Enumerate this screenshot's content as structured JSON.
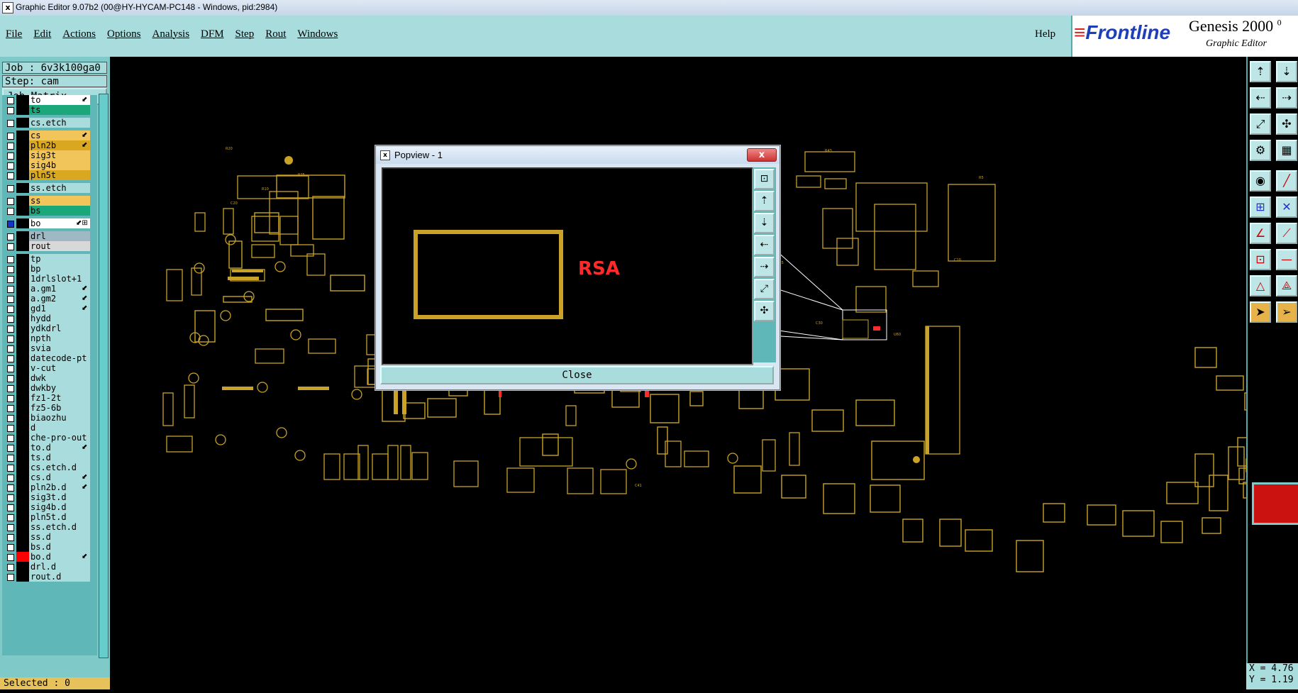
{
  "window": {
    "title": "Graphic Editor 9.07b2 (00@HY-HYCAM-PC148 - Windows, pid:2984)"
  },
  "menu": [
    "File",
    "Edit",
    "Actions",
    "Options",
    "Analysis",
    "DFM",
    "Step",
    "Rout",
    "Windows"
  ],
  "help": "Help",
  "brand": {
    "name": "Frontline",
    "product": "Genesis 2000",
    "version_fragment": "0",
    "subtitle": "Graphic Editor"
  },
  "job": {
    "job_label": "Job : 6v3k100ga0",
    "step_label": "Step: cam",
    "matrix_button": "Job Matrix ..."
  },
  "layers": [
    {
      "name": "to",
      "color": "#ffffff",
      "flag": "⬋"
    },
    {
      "name": "ts",
      "color": "#1aa77a",
      "flag": ""
    },
    {
      "name": "cs.etch",
      "color": "#a9dcdc",
      "flag": ""
    },
    {
      "name": "cs",
      "color": "#f2c55a",
      "flag": "⬋"
    },
    {
      "name": "pln2b",
      "color": "#d9a820",
      "flag": "⬋"
    },
    {
      "name": "sig3t",
      "color": "#f2c55a",
      "flag": ""
    },
    {
      "name": "sig4b",
      "color": "#f2c55a",
      "flag": ""
    },
    {
      "name": "pln5t",
      "color": "#d9a820",
      "flag": ""
    },
    {
      "name": "ss.etch",
      "color": "#a9dcdc",
      "flag": ""
    },
    {
      "name": "ss",
      "color": "#f2c55a",
      "flag": ""
    },
    {
      "name": "bs",
      "color": "#1aa77a",
      "flag": ""
    },
    {
      "name": "bo",
      "color": "#ffffff",
      "flag": "⬋⊞",
      "active": true
    },
    {
      "name": "drl",
      "color": "#9fb9c4",
      "flag": ""
    },
    {
      "name": "rout",
      "color": "#d8d8d8",
      "flag": ""
    },
    {
      "name": "tp",
      "color": "#a9dcdc",
      "flag": ""
    },
    {
      "name": "bp",
      "color": "#a9dcdc",
      "flag": ""
    },
    {
      "name": "1drlslot+1",
      "color": "#a9dcdc",
      "flag": ""
    },
    {
      "name": "a.gm1",
      "color": "#a9dcdc",
      "flag": "⬋"
    },
    {
      "name": "a.gm2",
      "color": "#a9dcdc",
      "flag": "⬋"
    },
    {
      "name": "gd1",
      "color": "#a9dcdc",
      "flag": "⬋"
    },
    {
      "name": "hydd",
      "color": "#a9dcdc",
      "flag": ""
    },
    {
      "name": "ydkdrl",
      "color": "#a9dcdc",
      "flag": ""
    },
    {
      "name": "npth",
      "color": "#a9dcdc",
      "flag": ""
    },
    {
      "name": "svia",
      "color": "#a9dcdc",
      "flag": ""
    },
    {
      "name": "datecode-pt",
      "color": "#a9dcdc",
      "flag": ""
    },
    {
      "name": "v-cut",
      "color": "#a9dcdc",
      "flag": ""
    },
    {
      "name": "dwk",
      "color": "#a9dcdc",
      "flag": ""
    },
    {
      "name": "dwkby",
      "color": "#a9dcdc",
      "flag": ""
    },
    {
      "name": "fz1-2t",
      "color": "#a9dcdc",
      "flag": ""
    },
    {
      "name": "fz5-6b",
      "color": "#a9dcdc",
      "flag": ""
    },
    {
      "name": "biaozhu",
      "color": "#a9dcdc",
      "flag": ""
    },
    {
      "name": "d",
      "color": "#a9dcdc",
      "flag": ""
    },
    {
      "name": "che-pro-out",
      "color": "#a9dcdc",
      "flag": ""
    },
    {
      "name": "to.d",
      "color": "#a9dcdc",
      "flag": "⬋"
    },
    {
      "name": "ts.d",
      "color": "#a9dcdc",
      "flag": ""
    },
    {
      "name": "cs.etch.d",
      "color": "#a9dcdc",
      "flag": ""
    },
    {
      "name": "cs.d",
      "color": "#a9dcdc",
      "flag": "⬋"
    },
    {
      "name": "pln2b.d",
      "color": "#a9dcdc",
      "flag": "⬋"
    },
    {
      "name": "sig3t.d",
      "color": "#a9dcdc",
      "flag": ""
    },
    {
      "name": "sig4b.d",
      "color": "#a9dcdc",
      "flag": ""
    },
    {
      "name": "pln5t.d",
      "color": "#a9dcdc",
      "flag": ""
    },
    {
      "name": "ss.etch.d",
      "color": "#a9dcdc",
      "flag": ""
    },
    {
      "name": "ss.d",
      "color": "#a9dcdc",
      "flag": ""
    },
    {
      "name": "bs.d",
      "color": "#a9dcdc",
      "flag": ""
    },
    {
      "name": "bo.d",
      "color": "#a9dcdc",
      "flag": "⬋",
      "swatch": "#ff0000"
    },
    {
      "name": "drl.d",
      "color": "#a9dcdc",
      "flag": ""
    },
    {
      "name": "rout.d",
      "color": "#a9dcdc",
      "flag": ""
    }
  ],
  "status": {
    "selected": "Selected : 0"
  },
  "coords": {
    "x": "X = 4.76",
    "y": "Y = 1.19"
  },
  "popview": {
    "title": "Popview - 1",
    "close_label": "Close",
    "close_x": "x",
    "sample_text": "RSA"
  },
  "colors": {
    "trace": "#c9a227",
    "highlight": "#ff2a2a",
    "panel": "#a9dcdc"
  }
}
